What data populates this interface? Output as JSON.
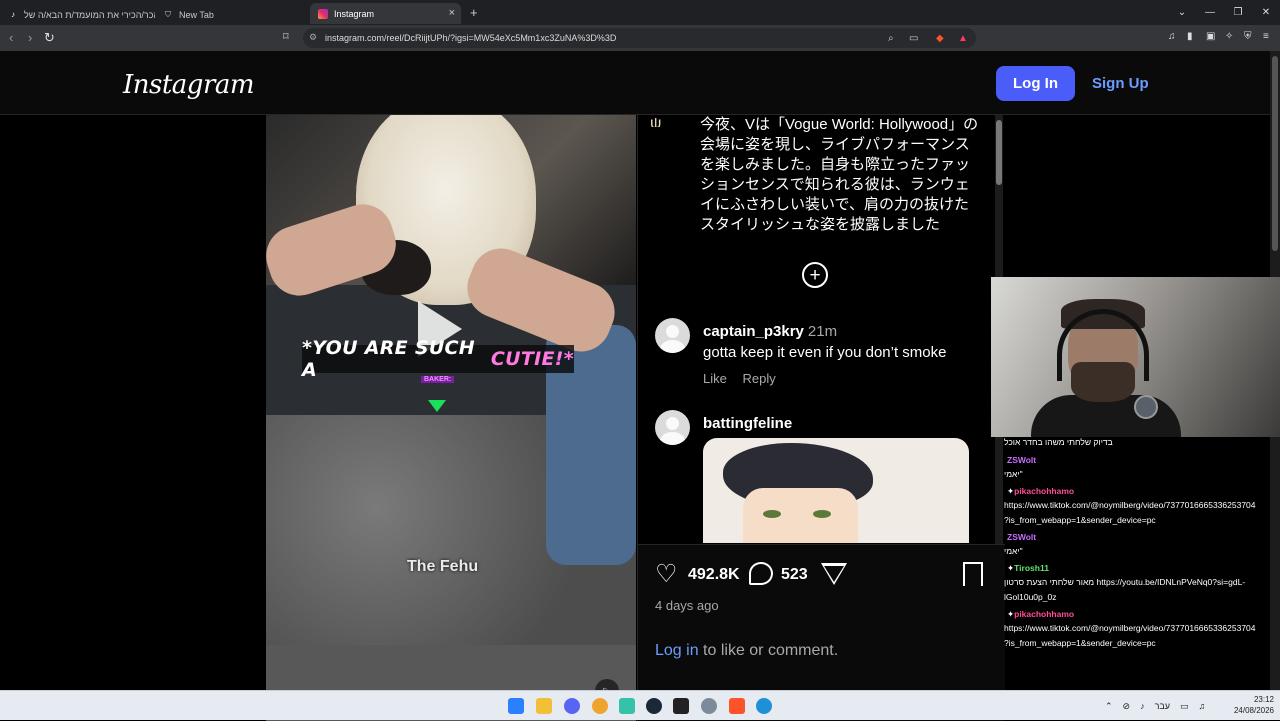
{
  "browser": {
    "tabs": [
      {
        "title": "הכר/הכירי את המועמד/ת הבא/ה של",
        "icon": "tiktok-icon"
      },
      {
        "title": "New Tab",
        "icon": "brave-shield-icon"
      },
      {
        "title": "Instagram",
        "icon": "instagram-icon"
      }
    ],
    "url": "instagram.com/reel/DcRiijtUPh/?igsi=MW54eXc5Mm1xc3ZuNA%3D%3D"
  },
  "instagram": {
    "logo": "Instagram",
    "login_label": "Log In",
    "signup_label": "Sign Up",
    "video": {
      "caption_part1": "*YOU ARE SUCH A ",
      "caption_part2": "CUTIE!*",
      "baker_label": "BAKER:",
      "watermark": "The Fehu"
    },
    "post_caption": "今夜、Vは「Vogue World: Hollywood」の会場に姿を現し、ライブパフォーマンスを楽しみました。自身も際立ったファッションセンスで知られる彼は、ランウェイにふさわしい装いで、肩の力の抜けたスタイリッシュな姿を披露しました",
    "comments": [
      {
        "user": "captain_p3kry",
        "time": "21m",
        "text": "gotta keep it even if you don’t smoke",
        "like": "Like",
        "reply": "Reply"
      },
      {
        "user": "battingfeline"
      }
    ],
    "likes": "492.8K",
    "comment_count": "523",
    "post_age": "4 days ago",
    "login_link": "Log in",
    "login_suffix": " to like or comment."
  },
  "stream_chat": [
    {
      "type": "text",
      "text": "בדיוק שלחתי משהו בחדר אוכל"
    },
    {
      "type": "user",
      "user": "ZSWolt",
      "color": "#c86cff"
    },
    {
      "type": "text",
      "text": "יאמי\""
    },
    {
      "type": "user",
      "user": "pikachohhamo",
      "color": "#ff4d94"
    },
    {
      "type": "text",
      "text": "https://www.tiktok.com/@noymilberg/video/7377016665336253704"
    },
    {
      "type": "text",
      "text": "?is_from_webapp=1&sender_device=pc"
    },
    {
      "type": "user",
      "user": "ZSWolt",
      "color": "#c86cff"
    },
    {
      "type": "text",
      "text": "יאמי\""
    },
    {
      "type": "user",
      "user": "Tirosh11",
      "color": "#62e36c"
    },
    {
      "type": "text",
      "text": "מאור שלחתי הצעת סרטון https://youtu.be/IDNLnPVeNq0?si=gdL-"
    },
    {
      "type": "text",
      "text": "lGol10u0p_0z"
    },
    {
      "type": "user",
      "user": "pikachohhamo",
      "color": "#ff4d94"
    },
    {
      "type": "text",
      "text": "https://www.tiktok.com/@noymilberg/video/7377016665336253704"
    },
    {
      "type": "text",
      "text": "?is_from_webapp=1&sender_device=pc"
    }
  ],
  "taskbar": {
    "lang": "עבר",
    "time": "23:12",
    "date": "24/08/2026"
  }
}
